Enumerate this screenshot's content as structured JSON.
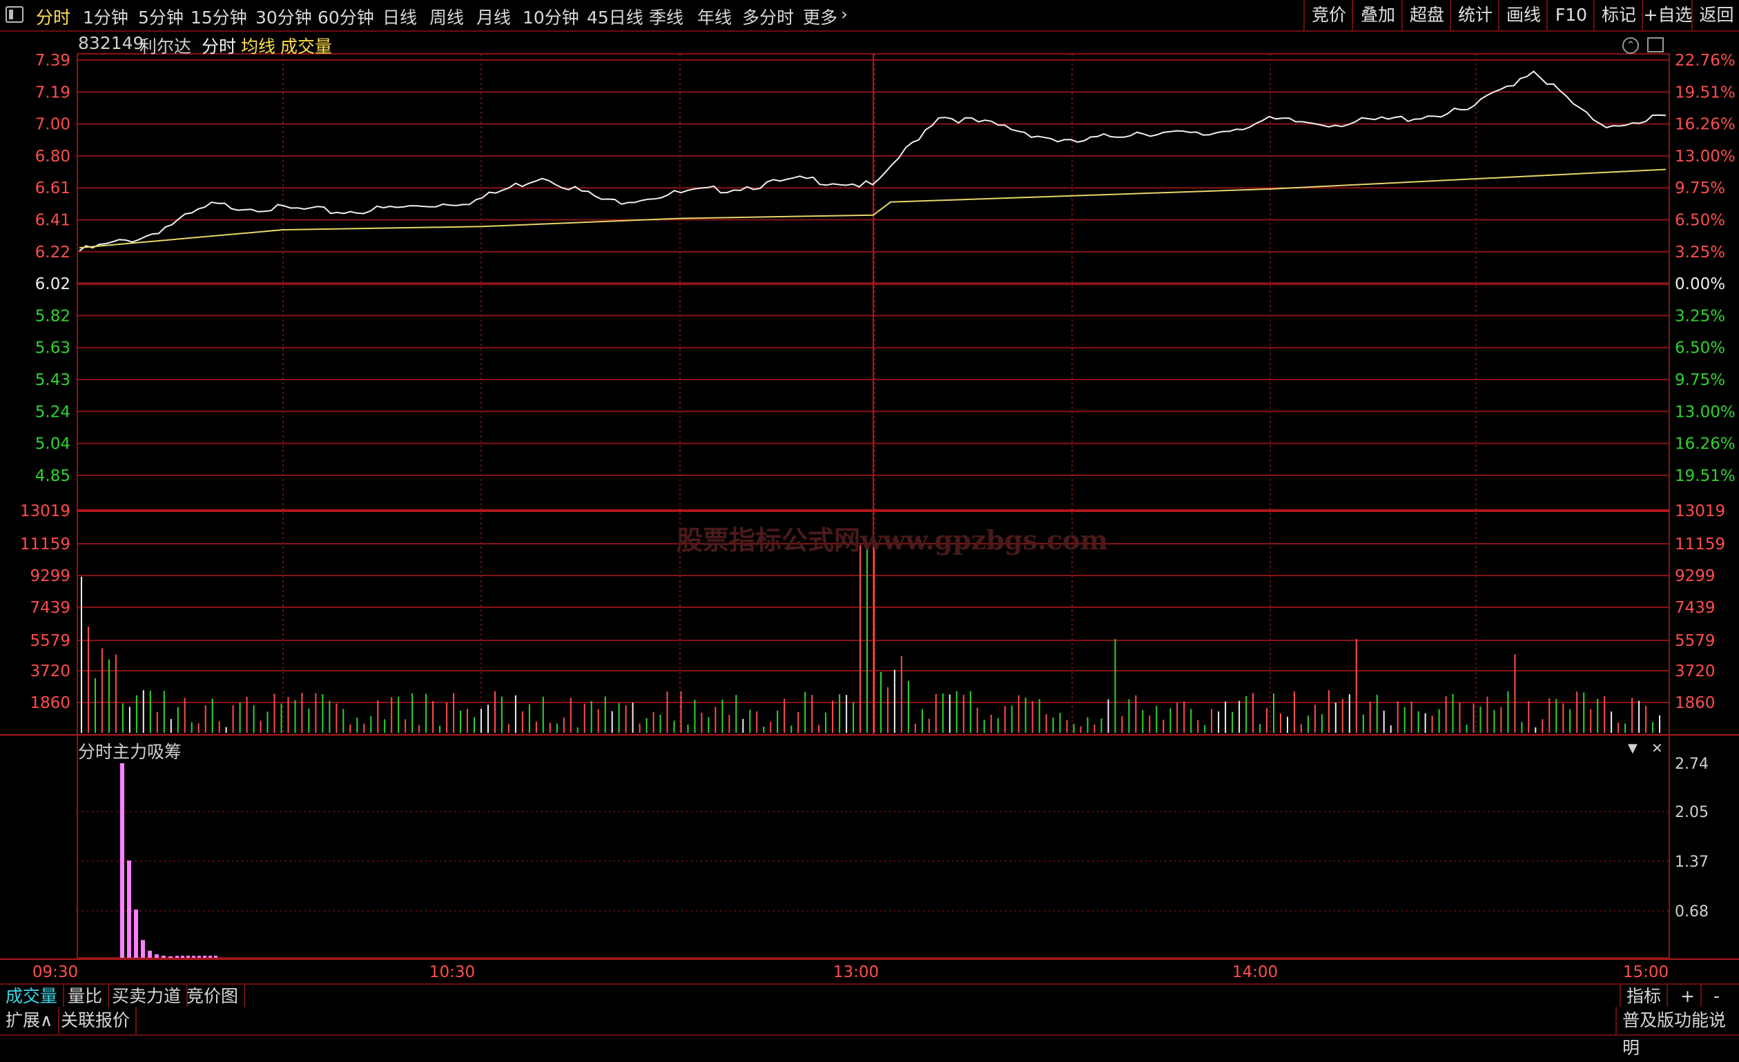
{
  "toolbar": {
    "periods": [
      "分时",
      "1分钟",
      "5分钟",
      "15分钟",
      "30分钟",
      "60分钟",
      "日线",
      "周线",
      "月线",
      "10分钟",
      "45日线",
      "季线",
      "年线",
      "多分时",
      "更多"
    ],
    "more_arrow": "›",
    "right_buttons": [
      "竞价",
      "叠加",
      "超盘",
      "统计",
      "画线",
      "F10",
      "标记",
      "+自选",
      "返回"
    ]
  },
  "header": {
    "code": "832149",
    "name": "利尔达",
    "mode": "分时",
    "avg_label": "均线",
    "vol_label": "成交量"
  },
  "price_axis": {
    "left_up": [
      "7.39",
      "7.19",
      "7.00",
      "6.80",
      "6.61",
      "6.41",
      "6.22"
    ],
    "base": "6.02",
    "left_down": [
      "5.82",
      "5.63",
      "5.43",
      "5.24",
      "5.04",
      "4.85"
    ],
    "right_up": [
      "22.76%",
      "19.51%",
      "16.26%",
      "13.00%",
      "9.75%",
      "6.50%",
      "3.25%"
    ],
    "right_base": "0.00%",
    "right_down": [
      "3.25%",
      "6.50%",
      "9.75%",
      "13.00%",
      "16.26%",
      "19.51%"
    ]
  },
  "volume_axis": [
    "13019",
    "11159",
    "9299",
    "7439",
    "5579",
    "3720",
    "1860"
  ],
  "indicator": {
    "title": "分时主力吸筹",
    "axis": [
      "2.74",
      "2.05",
      "1.37",
      "0.68"
    ],
    "dropdown_icon": "▼",
    "close_icon": "✕"
  },
  "time_axis": [
    "09:30",
    "10:30",
    "13:00",
    "14:00",
    "15:00"
  ],
  "bottom_tabs": [
    "成交量",
    "量比",
    "买卖力道",
    "竞价图"
  ],
  "bottom_right": [
    "指标",
    "+",
    "-"
  ],
  "status": {
    "expand": "扩展∧",
    "related": "关联报价",
    "edition": "普及版功能说明"
  },
  "watermark": "股票指标公式网www.gpzbgs.com",
  "colors": {
    "up": "#ff4d4d",
    "down": "#2ed42e",
    "price_line": "#f0f0f0",
    "avg_line": "#e8d66a",
    "grid": "#8a1414",
    "indicator_bar": "#ff7fff"
  },
  "chart_data": {
    "type": "line",
    "price_series": {
      "name": "分时",
      "x": [
        "09:30",
        "09:40",
        "09:50",
        "10:00",
        "10:10",
        "10:20",
        "10:30",
        "10:40",
        "10:50",
        "11:00",
        "11:10",
        "11:20",
        "11:30/13:00",
        "13:10",
        "13:20",
        "13:30",
        "13:40",
        "13:50",
        "14:00",
        "14:10",
        "14:20",
        "14:30",
        "14:40",
        "14:50",
        "15:00"
      ],
      "values": [
        6.22,
        6.31,
        6.5,
        6.48,
        6.46,
        6.49,
        6.53,
        6.68,
        6.52,
        6.57,
        6.61,
        6.66,
        6.62,
        7.05,
        6.98,
        6.88,
        6.95,
        6.93,
        7.02,
        7.0,
        7.03,
        7.08,
        7.33,
        6.98,
        7.05
      ]
    },
    "avg_series": {
      "name": "均线",
      "x": [
        "09:30",
        "10:00",
        "10:30",
        "11:00",
        "11:30/13:00",
        "13:10",
        "14:00",
        "15:00"
      ],
      "values": [
        6.24,
        6.35,
        6.37,
        6.42,
        6.44,
        6.52,
        6.6,
        6.72
      ]
    },
    "volume_peak": 13019,
    "indicator_values": [
      2.74,
      1.37,
      0.68,
      0.25,
      0.1,
      0.05,
      0.03,
      0.02
    ]
  }
}
